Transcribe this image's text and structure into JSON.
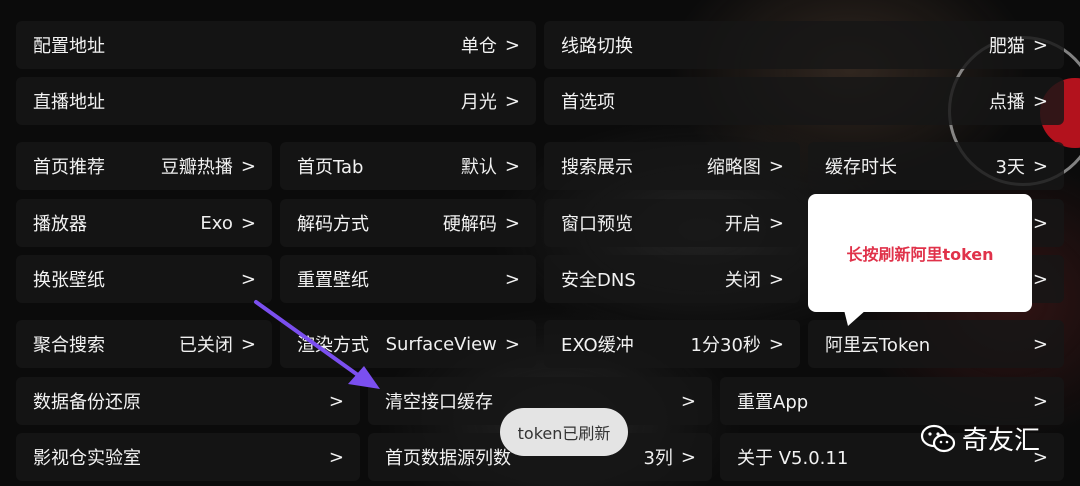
{
  "rows": [
    [
      {
        "label": "配置地址",
        "value": "单仓"
      },
      {
        "label": "线路切换",
        "value": "肥猫"
      }
    ],
    [
      {
        "label": "直播地址",
        "value": "月光"
      },
      {
        "label": "首选项",
        "value": "点播"
      }
    ],
    [
      {
        "label": "首页推荐",
        "value": "豆瓣热播"
      },
      {
        "label": "首页Tab",
        "value": "默认"
      },
      {
        "label": "搜索展示",
        "value": "缩略图"
      },
      {
        "label": "缓存时长",
        "value": "3天"
      }
    ],
    [
      {
        "label": "播放器",
        "value": "Exo"
      },
      {
        "label": "解码方式",
        "value": "硬解码"
      },
      {
        "label": "窗口预览",
        "value": "开启"
      },
      {
        "label": "",
        "value": ""
      }
    ],
    [
      {
        "label": "换张壁纸",
        "value": ""
      },
      {
        "label": "重置壁纸",
        "value": ""
      },
      {
        "label": "安全DNS",
        "value": "关闭"
      },
      {
        "label": "",
        "value": ""
      }
    ],
    [
      {
        "label": "聚合搜索",
        "value": "已关闭"
      },
      {
        "label": "渲染方式",
        "value": "SurfaceView"
      },
      {
        "label": "EXO缓冲",
        "value": "1分30秒"
      },
      {
        "label": "阿里云Token",
        "value": ""
      }
    ],
    [
      {
        "label": "数据备份还原",
        "value": ""
      },
      {
        "label": "清空接口缓存",
        "value": ""
      },
      {
        "label": "重置App",
        "value": ""
      }
    ],
    [
      {
        "label": "影视仓实验室",
        "value": ""
      },
      {
        "label": "首页数据源列数",
        "value": "3列"
      },
      {
        "label": "关于  V5.0.11",
        "value": ""
      }
    ]
  ],
  "chevron": ">",
  "toast": {
    "text": "token已刷新"
  },
  "tooltip": {
    "text": "长按刷新阿里token"
  },
  "watermark": {
    "text": "奇友汇"
  },
  "colors": {
    "arrow": "#7b4ff0",
    "tooltip_text": "#e0324a"
  }
}
